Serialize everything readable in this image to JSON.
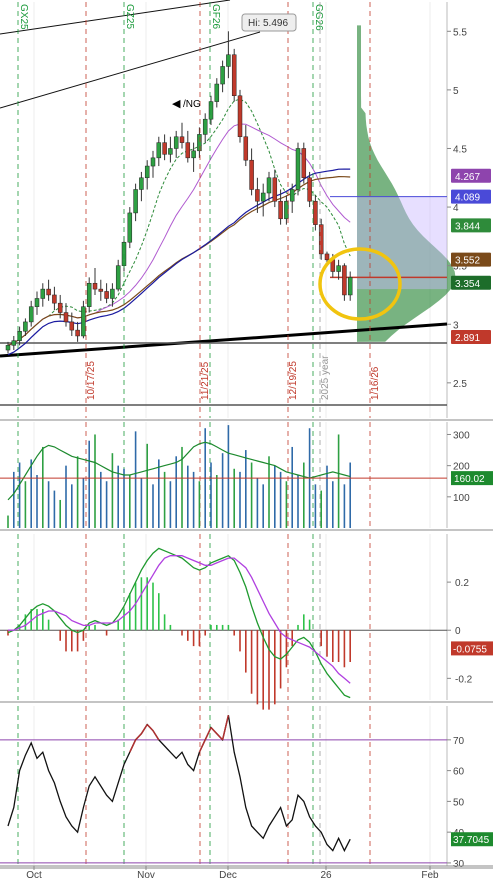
{
  "chart_data": {
    "type": "candlestick",
    "symbol_label": "/NG",
    "hi_label": "Hi: 5.496",
    "x_ticks": [
      "Oct",
      "Nov",
      "Dec",
      "26",
      "Feb"
    ],
    "event_labels": [
      {
        "text": "GX25",
        "color": "#1a9a3a"
      },
      {
        "text": "GZ25",
        "color": "#1a9a3a"
      },
      {
        "text": "GF26",
        "color": "#1a9a3a"
      },
      {
        "text": "GG26",
        "color": "#1a9a3a"
      },
      {
        "text": "10/17/25",
        "color": "#c0392b"
      },
      {
        "text": "11/21/25",
        "color": "#c0392b"
      },
      {
        "text": "12/19/25",
        "color": "#c0392b"
      },
      {
        "text": "2025 year",
        "color": "#999999"
      },
      {
        "text": "1/16/26",
        "color": "#c0392b"
      }
    ],
    "price": {
      "ylim": [
        2.2,
        5.75
      ],
      "ticks": [
        "2.5",
        "3",
        "3.5",
        "4",
        "4.5",
        "5",
        "5.5"
      ],
      "candles": [
        [
          2.78,
          2.85,
          2.75,
          2.82
        ],
        [
          2.82,
          2.9,
          2.78,
          2.86
        ],
        [
          2.86,
          2.98,
          2.82,
          2.94
        ],
        [
          2.94,
          3.05,
          2.9,
          3.02
        ],
        [
          3.02,
          3.2,
          2.98,
          3.15
        ],
        [
          3.15,
          3.28,
          3.08,
          3.22
        ],
        [
          3.22,
          3.35,
          3.15,
          3.3
        ],
        [
          3.3,
          3.38,
          3.2,
          3.25
        ],
        [
          3.25,
          3.32,
          3.12,
          3.18
        ],
        [
          3.18,
          3.25,
          3.05,
          3.1
        ],
        [
          3.1,
          3.18,
          2.98,
          3.02
        ],
        [
          3.02,
          3.1,
          2.9,
          2.95
        ],
        [
          2.95,
          3.02,
          2.85,
          2.9
        ],
        [
          2.9,
          3.2,
          2.88,
          3.15
        ],
        [
          3.15,
          3.4,
          3.1,
          3.35
        ],
        [
          3.35,
          3.48,
          3.25,
          3.3
        ],
        [
          3.3,
          3.38,
          3.2,
          3.28
        ],
        [
          3.28,
          3.35,
          3.18,
          3.22
        ],
        [
          3.22,
          3.35,
          3.15,
          3.3
        ],
        [
          3.3,
          3.55,
          3.28,
          3.5
        ],
        [
          3.5,
          3.75,
          3.45,
          3.7
        ],
        [
          3.7,
          4.0,
          3.65,
          3.95
        ],
        [
          3.95,
          4.2,
          3.88,
          4.15
        ],
        [
          4.15,
          4.3,
          4.05,
          4.25
        ],
        [
          4.25,
          4.4,
          4.15,
          4.35
        ],
        [
          4.35,
          4.48,
          4.25,
          4.42
        ],
        [
          4.42,
          4.6,
          4.35,
          4.55
        ],
        [
          4.55,
          4.62,
          4.4,
          4.45
        ],
        [
          4.45,
          4.6,
          4.38,
          4.5
        ],
        [
          4.5,
          4.65,
          4.42,
          4.6
        ],
        [
          4.6,
          4.72,
          4.5,
          4.55
        ],
        [
          4.55,
          4.65,
          4.38,
          4.42
        ],
        [
          4.42,
          4.55,
          4.3,
          4.48
        ],
        [
          4.48,
          4.68,
          4.42,
          4.62
        ],
        [
          4.62,
          4.8,
          4.55,
          4.75
        ],
        [
          4.75,
          4.95,
          4.7,
          4.9
        ],
        [
          4.9,
          5.1,
          4.85,
          5.05
        ],
        [
          5.05,
          5.25,
          4.98,
          5.2
        ],
        [
          5.2,
          5.5,
          5.1,
          5.3
        ],
        [
          5.3,
          5.35,
          4.9,
          4.95
        ],
        [
          4.95,
          5.0,
          4.55,
          4.6
        ],
        [
          4.6,
          4.7,
          4.35,
          4.4
        ],
        [
          4.4,
          4.5,
          4.1,
          4.15
        ],
        [
          4.15,
          4.25,
          3.95,
          4.05
        ],
        [
          4.05,
          4.2,
          3.92,
          4.12
        ],
        [
          4.12,
          4.3,
          4.05,
          4.25
        ],
        [
          4.25,
          4.32,
          4.0,
          4.05
        ],
        [
          4.05,
          4.15,
          3.85,
          3.9
        ],
        [
          3.9,
          4.1,
          3.85,
          4.05
        ],
        [
          4.05,
          4.2,
          3.95,
          4.15
        ],
        [
          4.15,
          4.55,
          4.1,
          4.5
        ],
        [
          4.5,
          4.55,
          4.2,
          4.25
        ],
        [
          4.25,
          4.3,
          4.0,
          4.05
        ],
        [
          4.05,
          4.1,
          3.8,
          3.85
        ],
        [
          3.85,
          3.9,
          3.55,
          3.6
        ],
        [
          3.6,
          3.62,
          3.52,
          3.55
        ],
        [
          3.55,
          3.6,
          3.4,
          3.45
        ],
        [
          3.45,
          3.55,
          3.38,
          3.5
        ],
        [
          3.5,
          3.52,
          3.2,
          3.25
        ],
        [
          3.25,
          3.45,
          3.2,
          3.4
        ]
      ],
      "badges": [
        {
          "text": "4.267",
          "value": 4.267,
          "color": "#8e44ad"
        },
        {
          "text": "4.089",
          "value": 4.089,
          "color": "#4a4ad8"
        },
        {
          "text": "3.844",
          "value": 3.844,
          "color": "#2e8b3a"
        },
        {
          "text": "3.552",
          "value": 3.552,
          "color": "#7a4a1a"
        },
        {
          "text": "3.354",
          "value": 3.354,
          "color": "#1d6d2a"
        },
        {
          "text": "2.891",
          "value": 2.891,
          "color": "#c0392b"
        }
      ]
    },
    "volume": {
      "ticks": [
        "100",
        "200",
        "300"
      ],
      "ylim": [
        0,
        340
      ],
      "last_label": "160.02",
      "last_value": 160,
      "values": [
        40,
        180,
        210,
        150,
        220,
        170,
        260,
        150,
        120,
        90,
        200,
        140,
        230,
        160,
        280,
        300,
        180,
        150,
        240,
        200,
        190,
        170,
        310,
        160,
        270,
        140,
        220,
        180,
        150,
        230,
        260,
        200,
        180,
        150,
        320,
        210,
        170,
        240,
        330,
        190,
        180,
        250,
        210,
        160,
        140,
        230,
        200,
        180,
        150,
        260,
        170,
        210,
        320,
        140,
        120,
        200,
        150,
        300,
        140,
        210
      ],
      "avg": [
        90,
        110,
        140,
        170,
        200,
        230,
        255,
        265,
        260,
        250,
        240,
        230,
        225,
        220,
        215,
        210,
        200,
        190,
        180,
        175,
        170,
        170,
        175,
        180,
        185,
        190,
        195,
        200,
        205,
        210,
        220,
        240,
        260,
        270,
        275,
        270,
        260,
        250,
        240,
        235,
        230,
        225,
        220,
        215,
        210,
        205,
        200,
        190,
        180,
        175,
        170,
        165,
        160,
        165,
        170,
        175,
        180,
        175,
        170,
        165
      ]
    },
    "macd": {
      "ylim": [
        -0.29,
        0.4
      ],
      "ticks": [
        "-0.2",
        "0",
        "0.2"
      ],
      "last_label": "-0.0755",
      "last_value": -0.0755,
      "macd": [
        -0.01,
        0.0,
        0.02,
        0.05,
        0.08,
        0.1,
        0.11,
        0.1,
        0.08,
        0.05,
        0.02,
        0.0,
        -0.01,
        0.0,
        0.03,
        0.04,
        0.03,
        0.02,
        0.03,
        0.06,
        0.1,
        0.15,
        0.2,
        0.25,
        0.29,
        0.32,
        0.34,
        0.33,
        0.32,
        0.31,
        0.3,
        0.28,
        0.26,
        0.25,
        0.26,
        0.28,
        0.29,
        0.3,
        0.31,
        0.29,
        0.24,
        0.18,
        0.1,
        0.03,
        -0.03,
        -0.08,
        -0.11,
        -0.12,
        -0.1,
        -0.07,
        -0.04,
        -0.03,
        -0.05,
        -0.09,
        -0.14,
        -0.18,
        -0.21,
        -0.24,
        -0.27,
        -0.28
      ],
      "signal": [
        0.0,
        0.0,
        0.01,
        0.02,
        0.04,
        0.06,
        0.07,
        0.08,
        0.08,
        0.07,
        0.06,
        0.04,
        0.03,
        0.02,
        0.02,
        0.03,
        0.03,
        0.03,
        0.03,
        0.04,
        0.06,
        0.08,
        0.11,
        0.15,
        0.19,
        0.23,
        0.27,
        0.3,
        0.31,
        0.31,
        0.31,
        0.3,
        0.29,
        0.28,
        0.27,
        0.27,
        0.28,
        0.29,
        0.3,
        0.3,
        0.28,
        0.26,
        0.22,
        0.17,
        0.12,
        0.07,
        0.03,
        -0.01,
        -0.03,
        -0.04,
        -0.05,
        -0.06,
        -0.07,
        -0.09,
        -0.11,
        -0.13,
        -0.15,
        -0.18,
        -0.2,
        -0.22
      ],
      "bar_positive_color": "#2ec24a",
      "bar_negative_color": "#c0392b"
    },
    "rsi": {
      "ylim": [
        29,
        81
      ],
      "ticks": [
        "30",
        "40",
        "50",
        "60",
        "70"
      ],
      "overbought": 70,
      "oversold": 30,
      "last_label": "37.7045",
      "last_value": 37.7,
      "values": [
        42,
        48,
        60,
        65,
        69,
        64,
        66,
        60,
        56,
        50,
        45,
        42,
        40,
        48,
        55,
        58,
        55,
        52,
        50,
        56,
        62,
        66,
        70,
        72,
        75,
        73,
        70,
        68,
        66,
        64,
        66,
        62,
        60,
        66,
        70,
        74,
        72,
        70,
        78,
        66,
        58,
        48,
        42,
        40,
        38,
        42,
        45,
        48,
        42,
        44,
        52,
        50,
        45,
        42,
        40,
        36,
        34,
        38,
        34,
        37.7
      ],
      "hi_color": "#b03030"
    }
  }
}
